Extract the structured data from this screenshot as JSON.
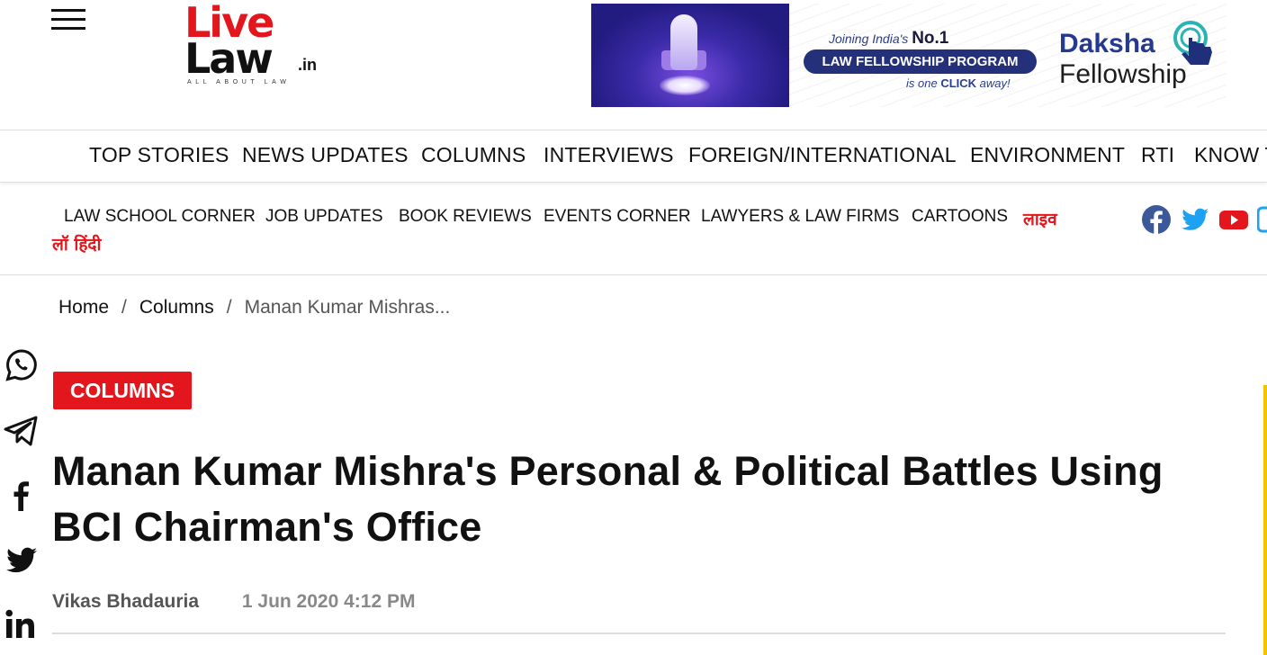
{
  "header": {
    "logo": {
      "line1": "Live",
      "line2": "Law",
      "tld": ".in",
      "tagline": "ALL ABOUT LAW"
    },
    "ad": {
      "joining": "Joining India's",
      "no1": "No.1",
      "program": "LAW FELLOWSHIP PROGRAM",
      "click_prefix": "is one",
      "click_bold": "CLICK",
      "click_suffix": "away!",
      "brand_line1": "Daksha",
      "brand_line2": "Fellowship"
    }
  },
  "nav_primary": [
    "TOP STORIES",
    "NEWS UPDATES",
    "COLUMNS",
    "INTERVIEWS",
    "FOREIGN/INTERNATIONAL",
    "ENVIRONMENT",
    "RTI",
    "KNOW THE LAW"
  ],
  "nav_secondary": [
    "LAW SCHOOL CORNER",
    "JOB UPDATES",
    "BOOK REVIEWS",
    "EVENTS CORNER",
    "LAWYERS & LAW FIRMS",
    "CARTOONS"
  ],
  "nav_hindi": {
    "line1": "लाइव",
    "line2": "लॉ हिंदी"
  },
  "breadcrumb": {
    "home": "Home",
    "section": "Columns",
    "current": "Manan Kumar Mishras...",
    "separator": "/"
  },
  "article": {
    "category": "COLUMNS",
    "title": "Manan Kumar Mishra's Personal & Political Battles Using BCI Chairman's Office",
    "author": "Vikas Bhadauria",
    "date": "1 Jun 2020 4:12 PM"
  },
  "colors": {
    "brand_red": "#e3161d",
    "facebook": "#3b5998",
    "twitter": "#1da1f2",
    "youtube": "#e3161d"
  }
}
